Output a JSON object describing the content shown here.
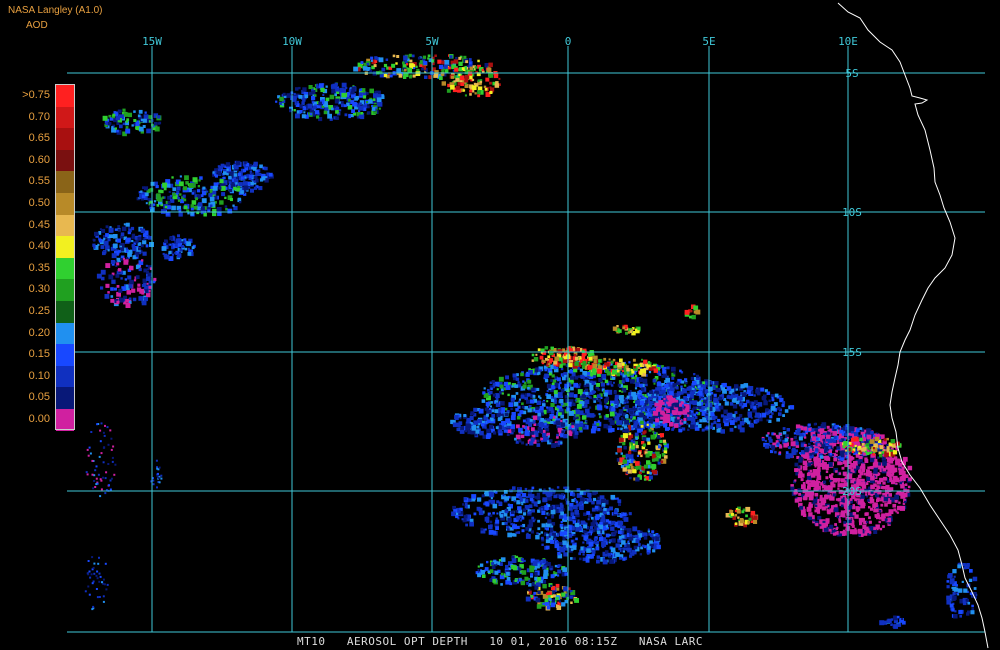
{
  "header": {
    "source": "NASA Langley (A1.0)",
    "product": "AOD"
  },
  "legend": {
    "entries": [
      {
        "label": ">0.75",
        "color": "#ff2020"
      },
      {
        "label": "0.70",
        "color": "#d01818"
      },
      {
        "label": "0.65",
        "color": "#a81010"
      },
      {
        "label": "0.60",
        "color": "#7a1010"
      },
      {
        "label": "0.55",
        "color": "#8a6418"
      },
      {
        "label": "0.50",
        "color": "#b88a28"
      },
      {
        "label": "0.45",
        "color": "#e8b850"
      },
      {
        "label": "0.40",
        "color": "#f2f020"
      },
      {
        "label": "0.35",
        "color": "#30d030"
      },
      {
        "label": "0.30",
        "color": "#20a020"
      },
      {
        "label": "0.25",
        "color": "#106018"
      },
      {
        "label": "0.20",
        "color": "#2090f0"
      },
      {
        "label": "0.15",
        "color": "#1848ff"
      },
      {
        "label": "0.10",
        "color": "#1030c0"
      },
      {
        "label": "0.05",
        "color": "#081878"
      },
      {
        "label": "0.00",
        "color": "#d020a0"
      }
    ]
  },
  "map": {
    "grid_color": "#40c8d8",
    "coast_color": "#ffffff",
    "lon_labels": [
      "15W",
      "10W",
      "5W",
      "0",
      "5E",
      "10E"
    ],
    "lat_labels": [
      "5S",
      "10S",
      "15S",
      "20S"
    ]
  },
  "footer": {
    "product": "MT10",
    "title": "AEROSOL OPT DEPTH",
    "date": "10 01, 2016 08:15Z",
    "agency": "NASA LARC"
  }
}
